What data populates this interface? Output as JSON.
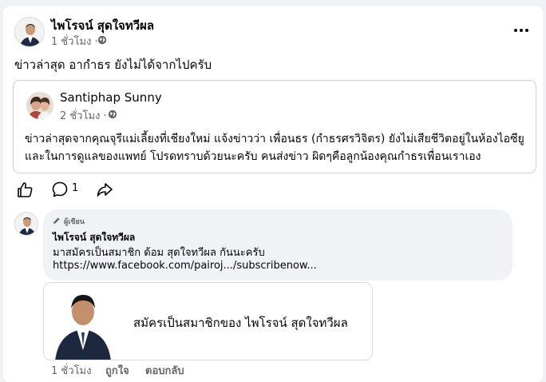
{
  "post": {
    "author": "ไพโรจน์ สุดใจทวีผล",
    "time": "1 ชั่วโมง ·",
    "text": "ข่าวล่าสุด อากำธร ยังไม่ได้จากไปครับ"
  },
  "shared": {
    "author": "Santiphap Sunny",
    "time": "2 ชั่วโมง ·",
    "lines": [
      "ข่าวล่าสุดจากคุณจุรีแม่เลี้ยงที่เชียงใหม่ แจ้งข่าวว่า เพื่อนธร (กำธรศรวิจิตร) ยังไม่เสียชีวิตอยู่ในห้องไอซียู",
      "และในการดูแลของแพทย์ โปรดทราบด้วยนะครับ คนส่งข่าว ผิดๆคือลูกน้องคุณกำธรเพื่อนเราเอง"
    ]
  },
  "actions": {
    "comment_count": "1"
  },
  "comment": {
    "badge": "ผู้เขียน",
    "author": "ไพโรจน์ สุดใจทวีผล",
    "text": "มาสมัครเป็นสมาชิก ด้อม สุดใจทวีผล กันนะครับ",
    "link": "https://www.facebook.com/pairoj.../subscribenow...",
    "preview_title": "สมัครเป็นสมาชิกของ ไพโรจน์ สุดใจทวีผล",
    "time": "1 ชั่วโมง",
    "like_label": "ถูกใจ",
    "reply_label": "ตอบกลับ"
  },
  "icons": {
    "privacy": "globe-icon",
    "more": "more-options-icon",
    "like": "thumbs-up-icon",
    "comment": "comment-bubble-icon",
    "share": "share-arrow-icon",
    "badge": "pencil-icon"
  }
}
